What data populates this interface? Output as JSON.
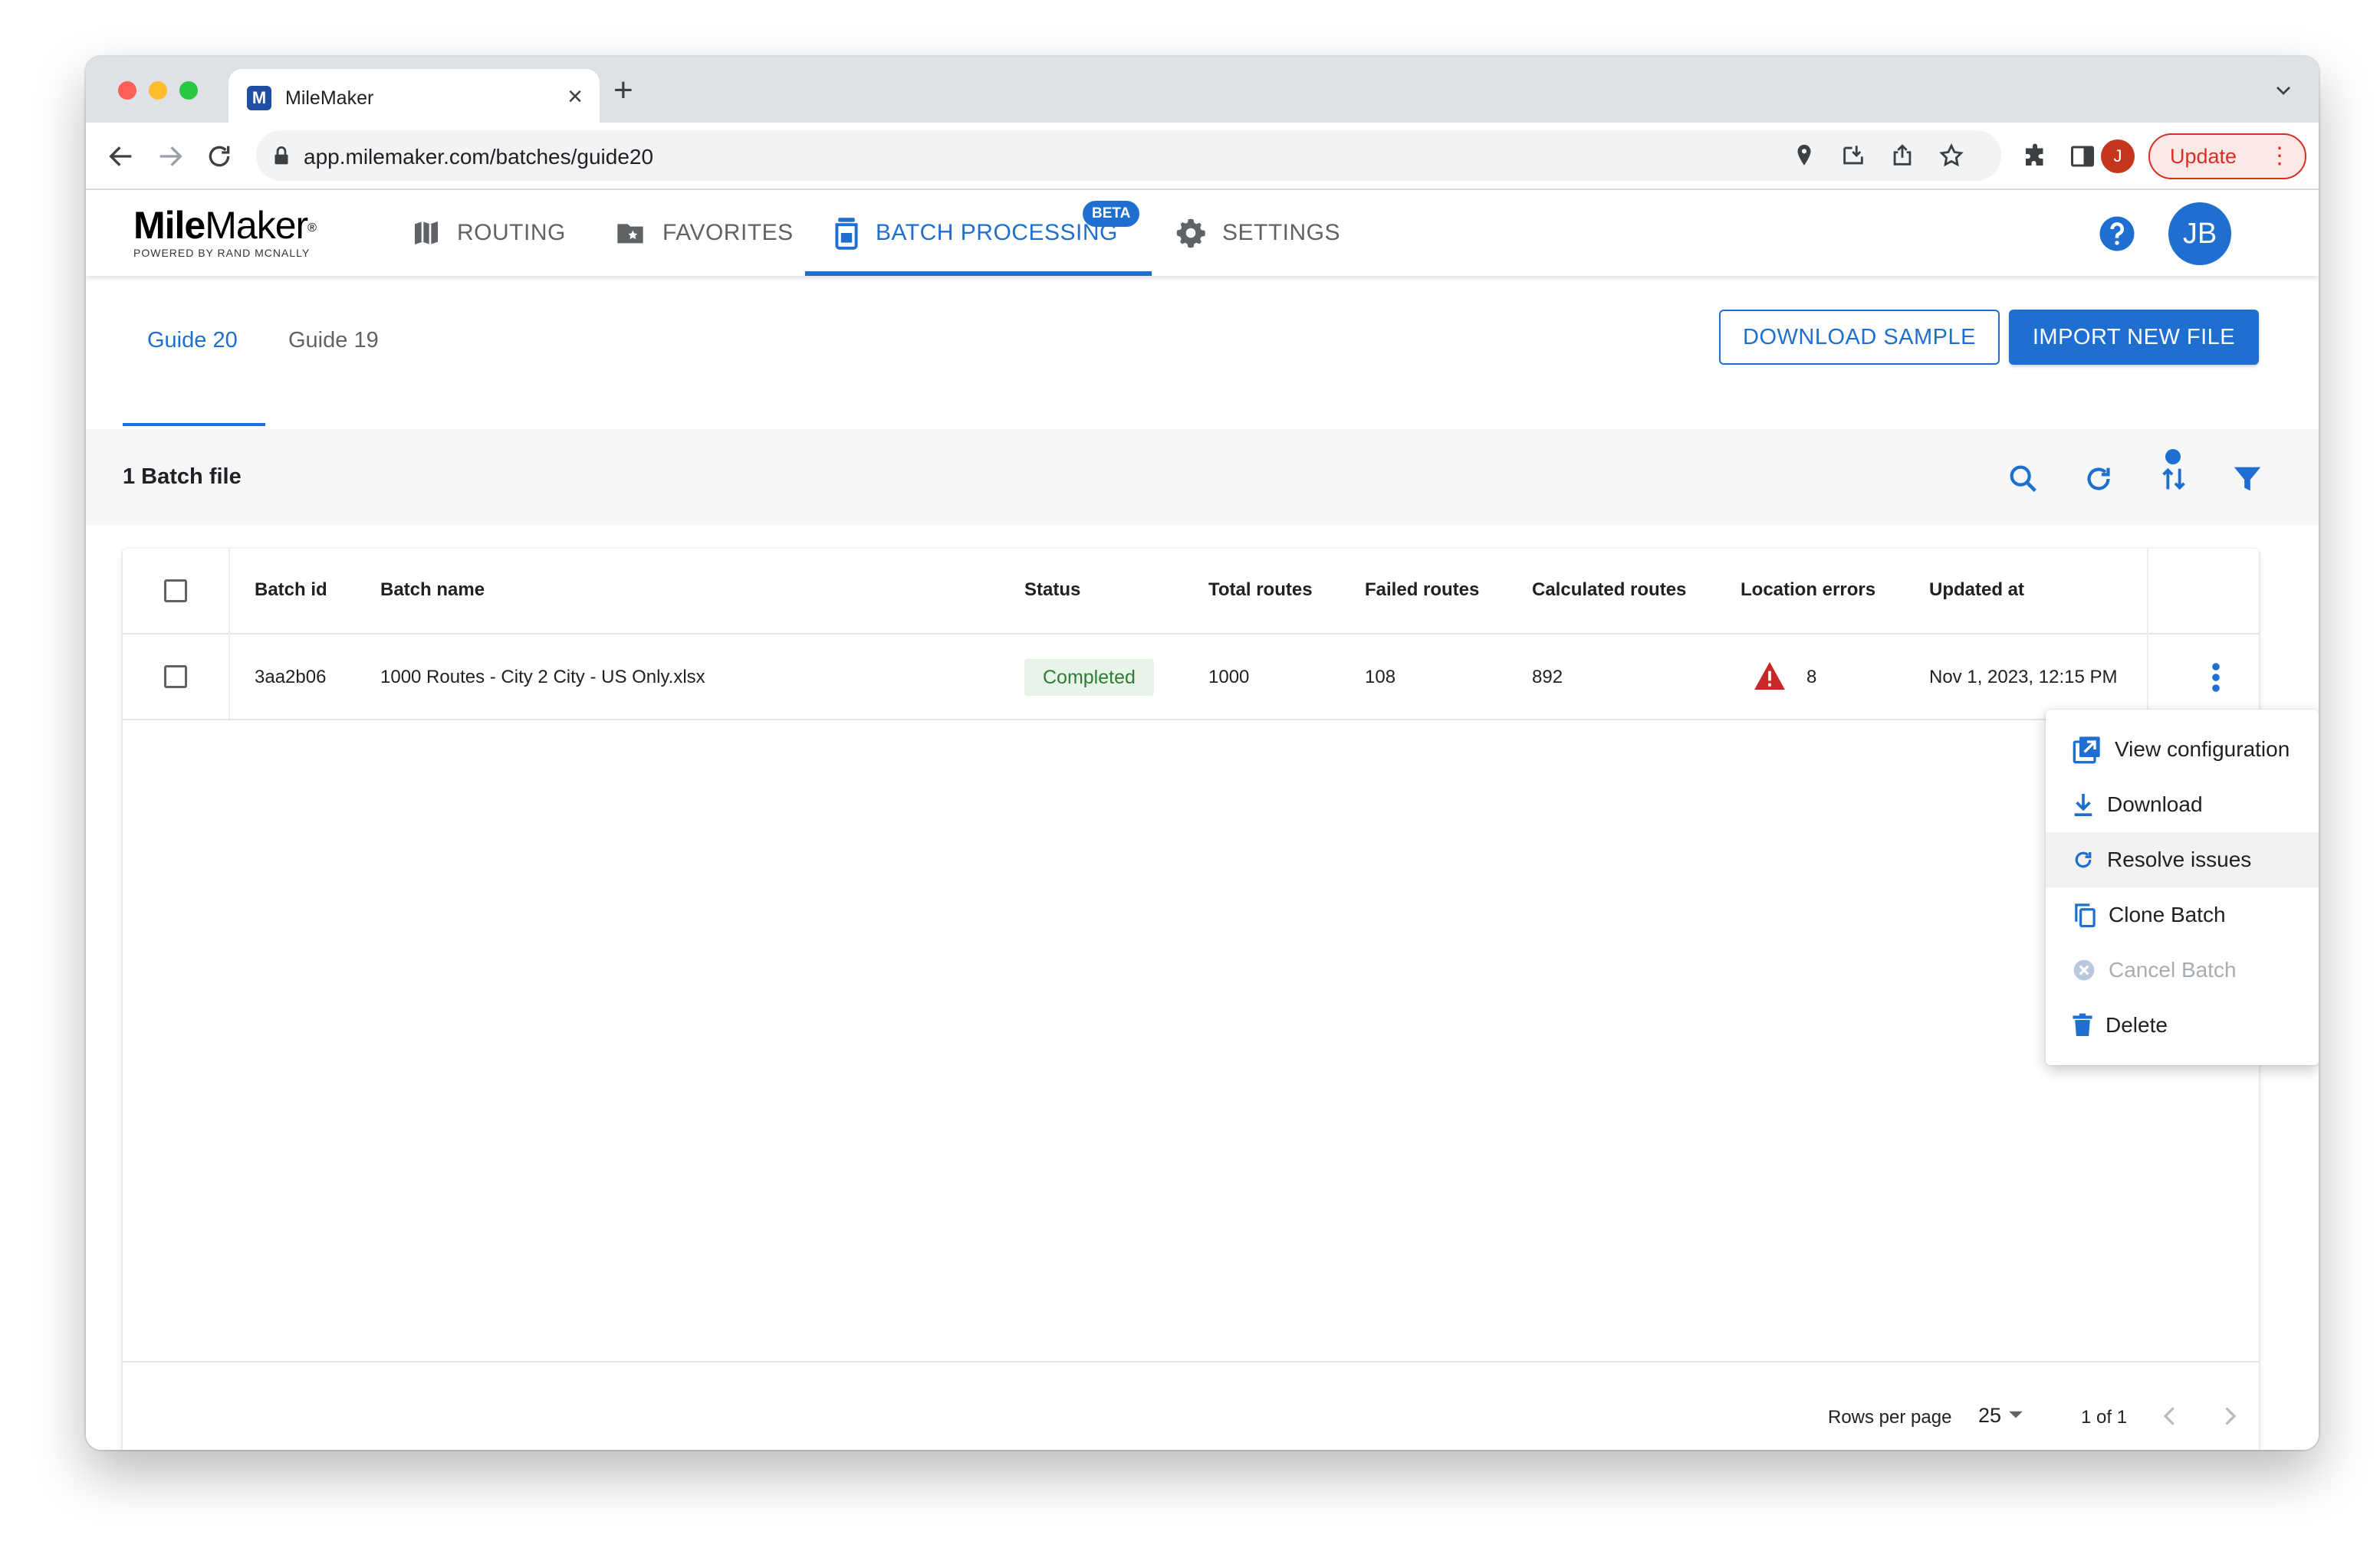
{
  "browser": {
    "tab_title": "MileMaker",
    "favicon_letter": "M",
    "url": "app.milemaker.com/batches/guide20",
    "profile_initial": "J",
    "update_label": "Update"
  },
  "app": {
    "logo_bold": "Mile",
    "logo_rest": "Maker",
    "logo_reg": "®",
    "logo_sub": "POWERED BY RAND MCNALLY",
    "nav": {
      "routing": "ROUTING",
      "favorites": "FAVORITES",
      "batch_processing": "BATCH PROCESSING",
      "settings": "SETTINGS"
    },
    "beta_badge": "BETA",
    "avatar_initials": "JB"
  },
  "page": {
    "tabs": [
      "Guide 20",
      "Guide 19"
    ],
    "download_sample": "DOWNLOAD SAMPLE",
    "import_new_file": "IMPORT NEW FILE",
    "batch_count": "1 Batch file"
  },
  "table": {
    "columns": [
      "Batch id",
      "Batch name",
      "Status",
      "Total routes",
      "Failed routes",
      "Calculated routes",
      "Location errors",
      "Updated at"
    ],
    "rows": [
      {
        "batch_id": "3aa2b06",
        "batch_name": "1000 Routes - City 2 City - US Only.xlsx",
        "status": "Completed",
        "total_routes": "1000",
        "failed_routes": "108",
        "calculated_routes": "892",
        "location_errors": "8",
        "updated_at": "Nov 1, 2023, 12:15 PM"
      }
    ],
    "footer": {
      "rows_per_page_label": "Rows per page",
      "rows_per_page": "25",
      "page_info": "1 of 1"
    }
  },
  "menu": {
    "items": [
      "View configuration",
      "Download",
      "Resolve issues",
      "Clone Batch",
      "Cancel Batch",
      "Delete"
    ]
  },
  "colors": {
    "accent": "#1f6fd1",
    "status_green": "#2e7d32",
    "warning_red": "#c62828"
  }
}
